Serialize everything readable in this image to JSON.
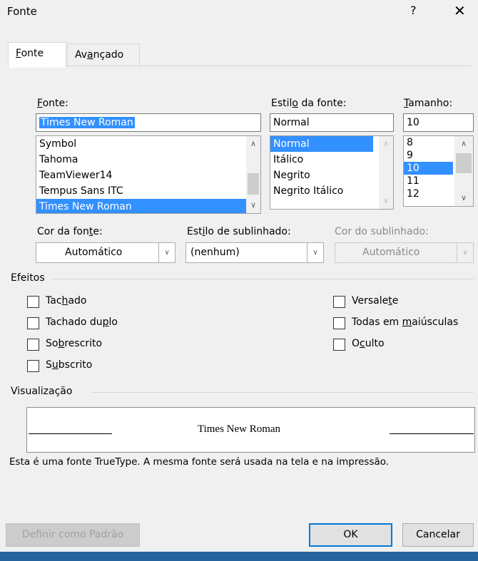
{
  "window": {
    "title": "Fonte",
    "help": "?",
    "close": "✕"
  },
  "tabs": [
    {
      "label": "Fonte",
      "access": "F",
      "rest": "onte"
    },
    {
      "label": "Avançado",
      "pre": "Av",
      "access": "a",
      "rest": "nçado"
    }
  ],
  "font": {
    "label_access": "F",
    "label_rest": "onte:",
    "value": "Times New Roman",
    "items": [
      "Symbol",
      "Tahoma",
      "TeamViewer14",
      "Tempus Sans ITC",
      "Times New Roman"
    ]
  },
  "style": {
    "label_pre": "Estil",
    "label_access": "o",
    "label_rest": " da fonte:",
    "value": "Normal",
    "items": [
      "Normal",
      "Itálico",
      "Negrito",
      "Negrito Itálico"
    ]
  },
  "size": {
    "label_access": "T",
    "label_rest": "amanho:",
    "value": "10",
    "items": [
      "8",
      "9",
      "10",
      "11",
      "12"
    ]
  },
  "color": {
    "label_pre": "Cor da fon",
    "label_access": "t",
    "label_rest": "e:",
    "value": "Automático"
  },
  "underline_style": {
    "label_pre": "Est",
    "label_access": "i",
    "label_rest": "lo de sublinhado:",
    "value": "(nenhum)"
  },
  "underline_color": {
    "label": "Cor do sublinhado:",
    "value": "Automático"
  },
  "effects": {
    "title": "Efeitos",
    "left": [
      {
        "pre": "Tac",
        "access": "h",
        "rest": "ado"
      },
      {
        "pre": "Tachado du",
        "access": "p",
        "rest": "lo"
      },
      {
        "pre": "So",
        "access": "b",
        "rest": "rescrito"
      },
      {
        "pre": "S",
        "access": "u",
        "rest": "bscrito"
      }
    ],
    "right": [
      {
        "pre": "Versale",
        "access": "t",
        "rest": "e"
      },
      {
        "pre": "Todas em ",
        "access": "m",
        "rest": "aiúsculas"
      },
      {
        "pre": "O",
        "access": "c",
        "rest": "ulto"
      }
    ]
  },
  "preview": {
    "title": "Visualização",
    "sample": "Times New Roman",
    "note": "Esta é uma fonte TrueType. A mesma fonte será usada na tela e na impressão."
  },
  "buttons": {
    "default": "Definir como Padrão",
    "ok": "OK",
    "cancel": "Cancelar"
  },
  "colors": {
    "selection": "#3390ff",
    "ok_border": "#0078d7",
    "taskbar": "#26639c"
  }
}
